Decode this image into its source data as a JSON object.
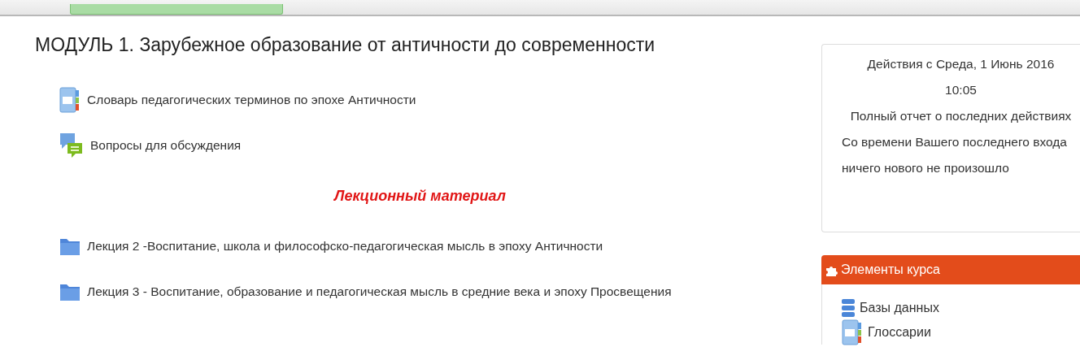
{
  "module": {
    "title": "МОДУЛЬ 1. Зарубежное образование от античности до современности",
    "items": [
      {
        "kind": "glossary",
        "label": "Словарь педагогических терминов по эпохе Античности"
      },
      {
        "kind": "forum",
        "label": "Вопросы для обсуждения"
      },
      {
        "kind": "heading",
        "label": "Лекционный материал"
      },
      {
        "kind": "folder",
        "label": "Лекция 2 -Воспитание, школа и философско-педагогическая мысль в эпоху Античности"
      },
      {
        "kind": "folder",
        "label": "Лекция 3 - Воспитание, образование и педагогическая мысль в средние века и эпоху Просвещения"
      }
    ]
  },
  "recent_activity": {
    "since": "Действия с Среда, 1 Июнь 2016",
    "time": "10:05",
    "report_link": "Полный отчет о последних действиях",
    "message": "Со времени Вашего последнего входа ничего нового не произошло"
  },
  "course_elements": {
    "title": "Элементы курса",
    "items": [
      {
        "kind": "database",
        "label": "Базы данных"
      },
      {
        "kind": "glossary",
        "label": "Глоссарии"
      }
    ]
  }
}
